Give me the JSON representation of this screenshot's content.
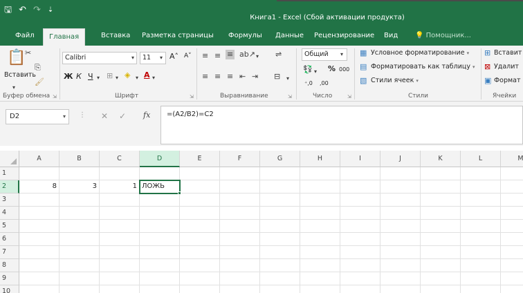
{
  "window": {
    "title": "Книга1 - Excel (Сбой активации продукта)"
  },
  "quick_access": {
    "save": "🖫",
    "undo": "↶",
    "redo": "↷",
    "customize": "⇣"
  },
  "tabs": [
    {
      "label": "Файл"
    },
    {
      "label": "Главная"
    },
    {
      "label": "Вставка"
    },
    {
      "label": "Разметка страницы"
    },
    {
      "label": "Формулы"
    },
    {
      "label": "Данные"
    },
    {
      "label": "Рецензирование"
    },
    {
      "label": "Вид"
    },
    {
      "label": "Помощник..."
    }
  ],
  "ribbon": {
    "paste_label": "Вставить",
    "font_name": "Calibri",
    "font_size": "11",
    "bold": "Ж",
    "italic": "К",
    "underline": "Ч",
    "grow_font": "A˄",
    "shrink_font": "A˅",
    "number_format": "Общий",
    "percent": "%",
    "thousands": "000",
    "inc_decimal": "⁺,0",
    "dec_decimal": ",00",
    "conditional_formatting": "Условное форматирование",
    "format_as_table": "Форматировать как таблицу",
    "cell_styles": "Стили ячеек",
    "insert": "Вставит",
    "delete": "Удалит",
    "format": "Формат",
    "groups": {
      "clipboard": "Буфер обмена",
      "font": "Шрифт",
      "alignment": "Выравнивание",
      "number": "Число",
      "styles": "Стили",
      "cells": "Ячейки"
    }
  },
  "formula_bar": {
    "name_box": "D2",
    "cancel": "✕",
    "enter": "✓",
    "fx": "fx",
    "formula": "=(A2/B2)=C2"
  },
  "grid": {
    "columns": [
      "A",
      "B",
      "C",
      "D",
      "E",
      "F",
      "G",
      "H",
      "I",
      "J",
      "K",
      "L",
      "M"
    ],
    "rows": [
      "1",
      "2",
      "3",
      "4",
      "5",
      "6",
      "7",
      "8",
      "9",
      "10"
    ],
    "selected_column": "D",
    "selected_row": "2",
    "cells": [
      {
        "ref": "A2",
        "value": "8",
        "align": "num"
      },
      {
        "ref": "B2",
        "value": "3",
        "align": "num"
      },
      {
        "ref": "C2",
        "value": "1",
        "align": "num"
      },
      {
        "ref": "D2",
        "value": "ЛОЖЬ",
        "align": "txt"
      }
    ],
    "active_cell": "D2"
  }
}
